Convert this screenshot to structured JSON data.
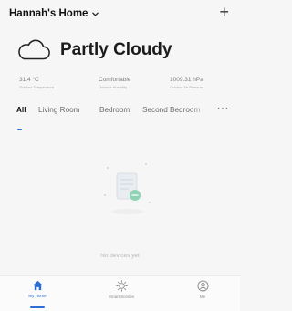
{
  "header": {
    "home_name": "Hannah's Home",
    "add_label": "+"
  },
  "weather": {
    "condition": "Partly Cloudy",
    "icon": "cloud-icon"
  },
  "stats": [
    {
      "value": "31.4 °C",
      "label": "Outdoor Temperature"
    },
    {
      "value": "Comfortable",
      "label": "Outdoor Humidity"
    },
    {
      "value": "1009.31 hPa",
      "label": "Outdoor Air Pressure"
    }
  ],
  "tabs": [
    {
      "label": "All",
      "active": true
    },
    {
      "label": "Living Room"
    },
    {
      "label": "Bedroom"
    },
    {
      "label": "Second Bedroom"
    }
  ],
  "more_label": "···",
  "empty_state": {
    "text": "No devices yet"
  },
  "bottom_nav": [
    {
      "label": "My Home",
      "icon": "home-icon",
      "active": true
    },
    {
      "label": "Smart Scenes",
      "icon": "sun-icon"
    },
    {
      "label": "Me",
      "icon": "user-icon"
    }
  ],
  "colors": {
    "accent": "#2c6ed6",
    "background": "#f6f6f7"
  }
}
